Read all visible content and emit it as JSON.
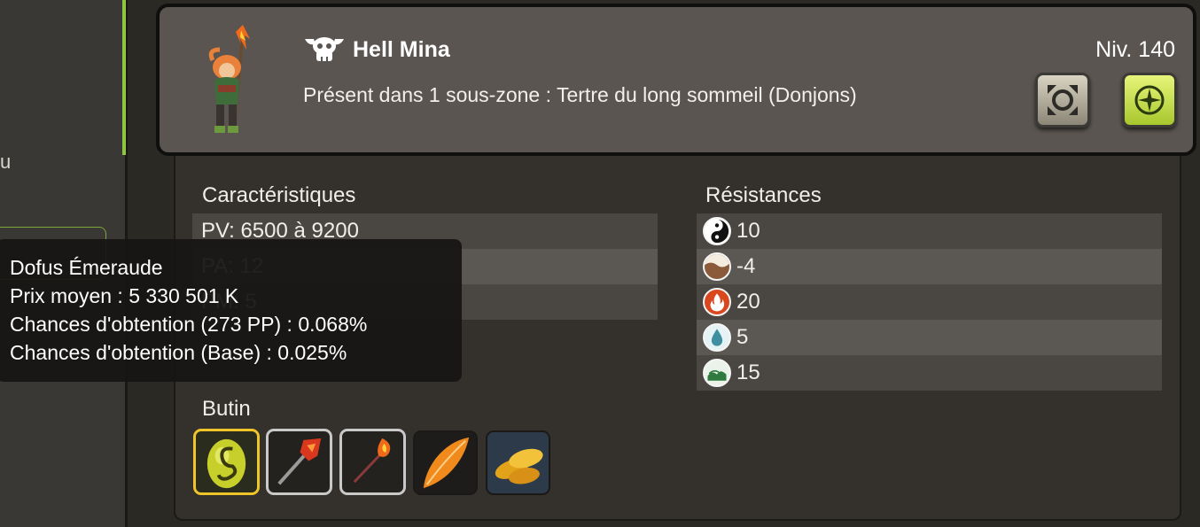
{
  "left_panel": {
    "partial_text": "u"
  },
  "header": {
    "monster_name": "Hell Mina",
    "level": "Niv. 140",
    "zone": "Présent dans 1 sous-zone : Tertre du long sommeil (Donjons)",
    "icons": [
      "boss-skull-icon",
      "fight-target-icon",
      "compass-map-icon"
    ]
  },
  "characteristics": {
    "title": "Caractéristiques",
    "rows": [
      "PV: 6500 à 9200",
      "PA: 12",
      "PM: 5"
    ]
  },
  "resistances": {
    "title": "Résistances",
    "rows": [
      {
        "element": "neutral",
        "icon": "yin-yang-icon",
        "value": "10",
        "color": "#111111"
      },
      {
        "element": "earth",
        "icon": "earth-icon",
        "value": "-4",
        "color": "#8a5a3a"
      },
      {
        "element": "fire",
        "icon": "fire-icon",
        "value": "20",
        "color": "#d8471e"
      },
      {
        "element": "water",
        "icon": "water-drop-icon",
        "value": "5",
        "color": "#3f8fa0"
      },
      {
        "element": "air",
        "icon": "air-icon",
        "value": "15",
        "color": "#2f7a3e"
      }
    ]
  },
  "loot": {
    "title": "Butin",
    "items": [
      "dofus-emeraude-icon",
      "red-staff-icon",
      "fire-wand-icon",
      "orange-feather-icon",
      "golden-seeds-icon"
    ]
  },
  "tooltip": {
    "item_name": "Dofus Émeraude",
    "price": "Prix moyen : 5 330 501 K",
    "chance_pp": "Chances d'obtention (273 PP) : 0.068%",
    "chance_base": "Chances d'obtention (Base) : 0.025%"
  },
  "colors": {
    "accent_green": "#8ec63f",
    "rarity_gold": "#f0c52a"
  }
}
